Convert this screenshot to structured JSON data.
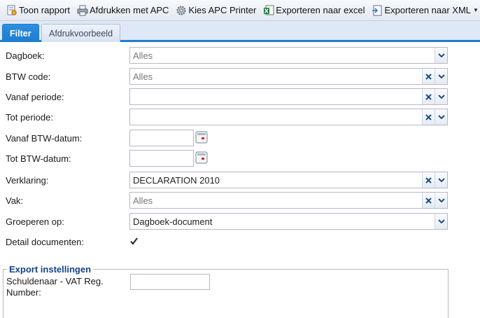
{
  "toolbar": {
    "toon_rapport": "Toon rapport",
    "afdrukken_apc": "Afdrukken met APC",
    "kies_apc_printer": "Kies APC Printer",
    "exporteren_excel": "Exporteren naar excel",
    "exporteren_xml": "Exporteren naar XML"
  },
  "tabs": [
    {
      "label": "Filter",
      "active": true
    },
    {
      "label": "Afdrukvoorbeeld",
      "active": false
    }
  ],
  "form": {
    "dagboek": {
      "label": "Dagboek:",
      "value": "Alles"
    },
    "btw_code": {
      "label": "BTW code:",
      "value": "Alles"
    },
    "vanaf_periode": {
      "label": "Vanaf periode:",
      "value": ""
    },
    "tot_periode": {
      "label": "Tot periode:",
      "value": ""
    },
    "vanaf_btw_datum": {
      "label": "Vanaf BTW-datum:",
      "value": ""
    },
    "tot_btw_datum": {
      "label": "Tot BTW-datum:",
      "value": ""
    },
    "verklaring": {
      "label": "Verklaring:",
      "value": "DECLARATION 2010"
    },
    "vak": {
      "label": "Vak:",
      "value": "Alles"
    },
    "groeperen_op": {
      "label": "Groeperen op:",
      "value": "Dagboek-document"
    },
    "detail_documenten": {
      "label": "Detail documenten:",
      "checked": true
    }
  },
  "export_settings": {
    "legend": "Export instellingen",
    "vat_reg_label": "Schuldenaar - VAT Reg. Number:",
    "vat_reg_value": ""
  },
  "icons": {
    "toon_rapport": "report-icon",
    "afdrukken": "printer-icon",
    "kies_printer": "gear-icon",
    "excel": "excel-icon",
    "xml": "xml-export-icon"
  },
  "colors": {
    "accent": "#1d7ccf",
    "legend_text": "#15428b",
    "muted_value": "#777777"
  }
}
